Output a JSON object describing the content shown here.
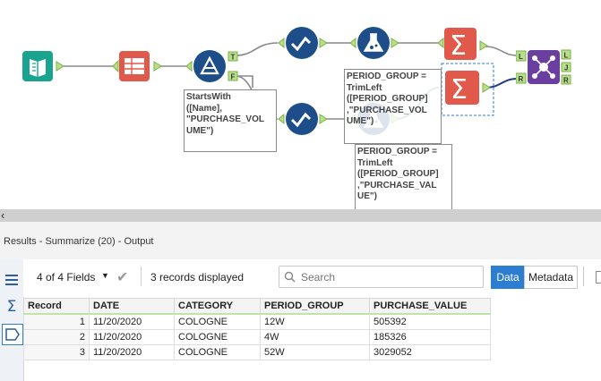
{
  "workflow": {
    "annotations": {
      "startswith": "StartsWith\n([Name],\n\"PURCHASE_VOL\nUME\")",
      "trimleft_a": "PERIOD_GROUP =\nTrimLeft\n([PERIOD_GROUP]\n,\"PURCHASE_VOL\nUME\")",
      "trimleft_b": "PERIOD_GROUP =\nTrimLeft\n([PERIOD_GROUP]\n,\"PURCHASE_VAL\nUE\")"
    },
    "anchors": {
      "true": "T",
      "false": "F",
      "left": "L",
      "right": "R",
      "join": "J"
    }
  },
  "results": {
    "title": "Results - Summarize (20) - Output",
    "fields_label": "4 of 4 Fields",
    "records_label": "3 records displayed",
    "search_placeholder": "Search",
    "data_tab": "Data",
    "metadata_tab": "Metadata",
    "columns": [
      "Record",
      "DATE",
      "CATEGORY",
      "PERIOD_GROUP",
      "PURCHASE_VALUE"
    ],
    "rows": [
      [
        "1",
        "11/20/2020",
        "COLOGNE",
        "12W",
        "505392"
      ],
      [
        "2",
        "11/20/2020",
        "COLOGNE",
        "4W",
        "185326"
      ],
      [
        "3",
        "11/20/2020",
        "COLOGNE",
        "52W",
        "3029052"
      ]
    ]
  },
  "colors": {
    "input_tool": "#1aa38f",
    "select_tool": "#e0594a",
    "filter_tool": "#1d4e89",
    "formula_tool": "#1d4e89",
    "summarize_tool": "#e0594a",
    "join_tool": "#6b3fa0",
    "connector": "#8a8a8a",
    "selected_blue": "#2d7dd2"
  }
}
